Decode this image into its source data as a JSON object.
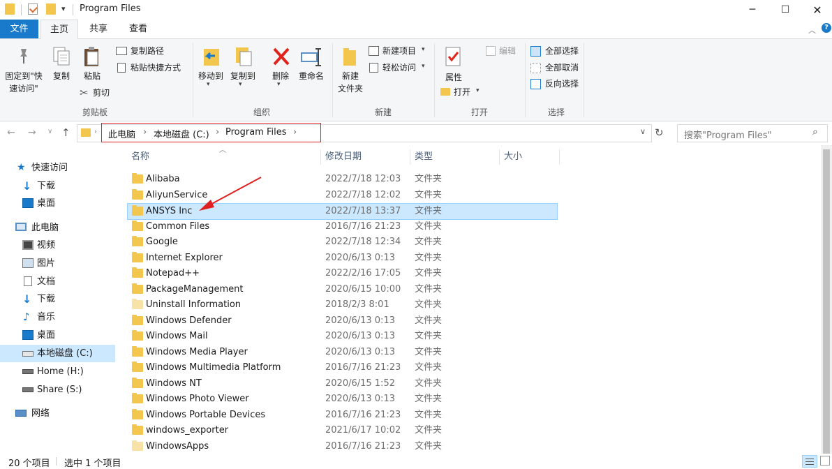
{
  "window": {
    "title": "Program Files"
  },
  "tabs": {
    "file": "文件",
    "home": "主页",
    "share": "共享",
    "view": "查看"
  },
  "ribbon": {
    "clipboard": {
      "pin": "固定到\"快速访问\"",
      "copy": "复制",
      "paste": "粘贴",
      "copy_path": "复制路径",
      "paste_shortcut": "粘贴快捷方式",
      "cut": "剪切",
      "group": "剪贴板"
    },
    "organize": {
      "move_to": "移动到",
      "copy_to": "复制到",
      "delete": "删除",
      "rename": "重命名",
      "group": "组织"
    },
    "new": {
      "new_folder": "新建\n文件夹",
      "new_item": "新建项目",
      "easy_access": "轻松访问",
      "group": "新建"
    },
    "open": {
      "properties": "属性",
      "open": "打开",
      "edit": "编辑",
      "group": "打开"
    },
    "select": {
      "select_all": "全部选择",
      "select_none": "全部取消",
      "invert": "反向选择",
      "group": "选择"
    }
  },
  "address": {
    "crumbs": [
      "此电脑",
      "本地磁盘 (C:)",
      "Program Files"
    ],
    "search_placeholder": "搜索\"Program Files\""
  },
  "nav": {
    "quick_access": "快速访问",
    "qa_downloads": "下载",
    "qa_desktop": "桌面",
    "this_pc": "此电脑",
    "videos": "视频",
    "pictures": "图片",
    "documents": "文档",
    "downloads": "下载",
    "music": "音乐",
    "desktop": "桌面",
    "local_disk": "本地磁盘 (C:)",
    "home": "Home (H:)",
    "share": "Share (S:)",
    "network": "网络"
  },
  "columns": {
    "name": "名称",
    "date": "修改日期",
    "type": "类型",
    "size": "大小"
  },
  "files": [
    {
      "name": "Alibaba",
      "date": "2022/7/18 12:03",
      "type": "文件夹"
    },
    {
      "name": "AliyunService",
      "date": "2022/7/18 12:02",
      "type": "文件夹"
    },
    {
      "name": "ANSYS Inc",
      "date": "2022/7/18 13:37",
      "type": "文件夹"
    },
    {
      "name": "Common Files",
      "date": "2016/7/16 21:23",
      "type": "文件夹"
    },
    {
      "name": "Google",
      "date": "2022/7/18 12:34",
      "type": "文件夹"
    },
    {
      "name": "Internet Explorer",
      "date": "2020/6/13 0:13",
      "type": "文件夹"
    },
    {
      "name": "Notepad++",
      "date": "2022/2/16 17:05",
      "type": "文件夹"
    },
    {
      "name": "PackageManagement",
      "date": "2020/6/15 10:00",
      "type": "文件夹"
    },
    {
      "name": "Uninstall Information",
      "date": "2018/2/3 8:01",
      "type": "文件夹"
    },
    {
      "name": "Windows Defender",
      "date": "2020/6/13 0:13",
      "type": "文件夹"
    },
    {
      "name": "Windows Mail",
      "date": "2020/6/13 0:13",
      "type": "文件夹"
    },
    {
      "name": "Windows Media Player",
      "date": "2020/6/13 0:13",
      "type": "文件夹"
    },
    {
      "name": "Windows Multimedia Platform",
      "date": "2016/7/16 21:23",
      "type": "文件夹"
    },
    {
      "name": "Windows NT",
      "date": "2020/6/15 1:52",
      "type": "文件夹"
    },
    {
      "name": "Windows Photo Viewer",
      "date": "2020/6/13 0:13",
      "type": "文件夹"
    },
    {
      "name": "Windows Portable Devices",
      "date": "2016/7/16 21:23",
      "type": "文件夹"
    },
    {
      "name": "windows_exporter",
      "date": "2021/6/17 10:02",
      "type": "文件夹"
    },
    {
      "name": "WindowsApps",
      "date": "2016/7/16 21:23",
      "type": "文件夹"
    }
  ],
  "status": {
    "count": "20 个项目",
    "selected": "选中 1 个项目"
  },
  "colors": {
    "accent": "#1979ca",
    "selection": "#cce8ff",
    "annotation": "#e02020",
    "folder": "#f3c64d"
  }
}
